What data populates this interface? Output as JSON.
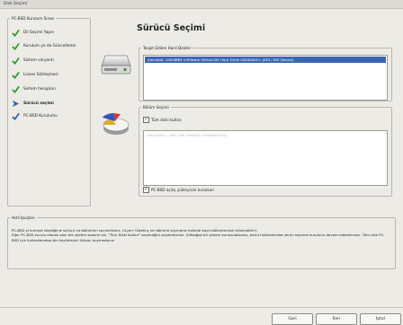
{
  "window": {
    "title": "Disk Seçimi"
  },
  "steps": {
    "legend": "PC-BSD Kurulum Sırası",
    "items": [
      {
        "label": "Dil Seçimi Yapın",
        "state": "done",
        "icon": "check-icon"
      },
      {
        "label": "Kurulum ya da Güncelleme",
        "state": "done",
        "icon": "check-icon"
      },
      {
        "label": "Sistem varyantı",
        "state": "done",
        "icon": "check-icon"
      },
      {
        "label": "Lisans Sözleşmesi",
        "state": "done",
        "icon": "check-icon"
      },
      {
        "label": "Sistem hesapları",
        "state": "done",
        "icon": "check-icon"
      },
      {
        "label": "Sürücü seçimi",
        "state": "current",
        "icon": "arrow-right-icon"
      },
      {
        "label": "PC-BSD Kurulumu",
        "state": "pending",
        "icon": "check-outline-icon"
      }
    ]
  },
  "page": {
    "heading": "Sürücü Seçimi"
  },
  "disks": {
    "legend": "Tespit Edilen Hard Diskler",
    "items": [
      "/dev/ad0: 10836MB <VMware Virtual IDE Hard Drive 00000001> (ATA / IDE Device)"
    ],
    "selected": 0
  },
  "partitions": {
    "legend": "Bölüm Seçimi",
    "use_full_disk_label": "Tüm diski kullan",
    "use_full_disk_checked": true,
    "items": [
      "/dev/ad0s1: 10617MB FreeBSD (FreeBSD/UFS)"
    ],
    "bootloader_label": "PC-BSD açılış yükleyicisi kurulsun",
    "bootloader_checked": true
  },
  "help": {
    "legend": "Hızlı İpuçları",
    "lines": [
      "PC-BSD yi kurmak istediğiniz sürücü ve bölümleri seçmelisiniz. (Uyarı: Üstelinç bir bölümü seçmeniz halinde kayıt bölümlerinizi silinecektir!)",
      "Eğer PC-BSD kurulu olacak olan tek işletim sistemi ise, \"Tüm Diski Kullan\" seçeneğini seçebilirsiniz. Çiftsağıgi bir sistem kurulacaksanız, birinci bölümlerden birini seçerek kurulunu devam edebilirsiniz. Tüm disk PC-BSD için kullanılacaksa bir önyükleyici ihtiyaç duymazsınız."
    ]
  },
  "buttons": {
    "back": "Geri",
    "next": "İleri",
    "cancel": "İptal"
  },
  "colors": {
    "selection": "#3b66b2",
    "check": "#2f9e2f",
    "current_arrow": "#3a5fb3",
    "window_bg": "#ecebe6"
  }
}
